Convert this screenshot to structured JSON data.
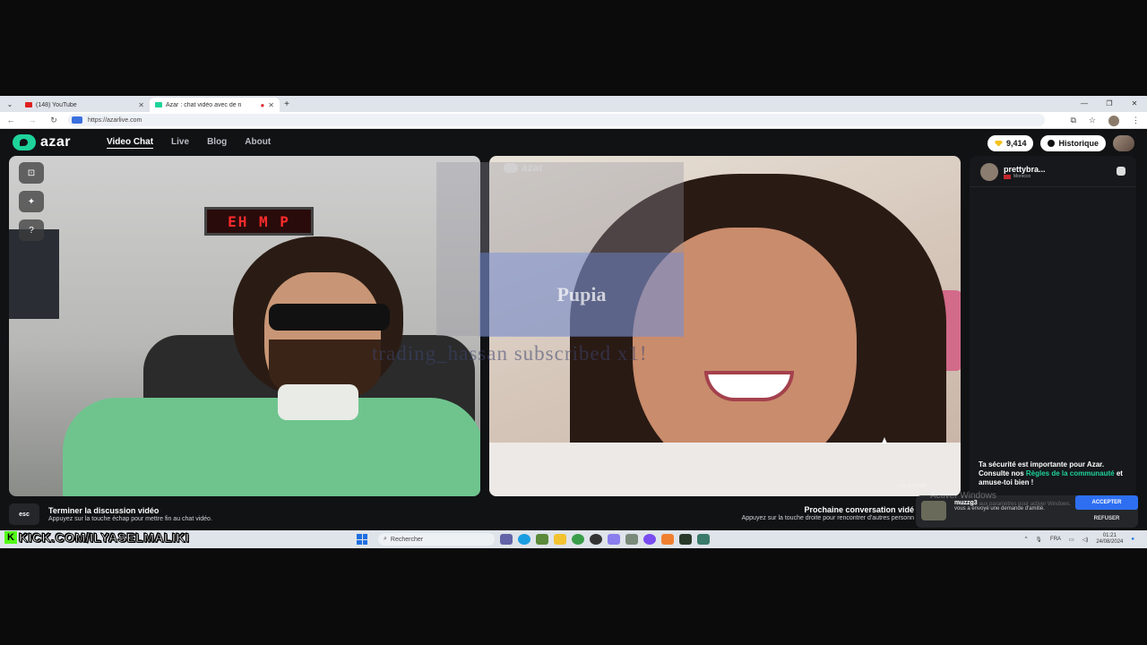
{
  "browser": {
    "tabs": [
      {
        "title": "(148) YouTube",
        "fav_color": "#e02020"
      },
      {
        "title": "Azar : chat vidéo avec de n",
        "fav_color": "#1ed39a"
      }
    ],
    "url": "https://azarlive.com"
  },
  "app": {
    "brand": "azar",
    "nav": [
      "Video Chat",
      "Live",
      "Blog",
      "About"
    ],
    "gems": "9,414",
    "history_label": "Historique",
    "accent": "#1ed39a"
  },
  "left_video": {
    "clock_text": "EH M P"
  },
  "right_video": {
    "watermark": "azar",
    "overlay_text": "Pupia",
    "tiny_id": "LIVE EXTRAS"
  },
  "stream_alert": "trading_hassan subscribed x1!",
  "side_panel": {
    "peer_name": "prettybra...",
    "peer_country": "Morocco",
    "safety_prefix": "Ta sécurité est importante pour Azar. Consulte nos ",
    "safety_link": "Règles de la communauté",
    "safety_suffix": " et amuse-toi bien !"
  },
  "hints": {
    "esc_key": "esc",
    "end_title": "Terminer la discussion vidéo",
    "end_sub": "Appuyez sur la touche échap pour mettre fin au chat vidéo.",
    "next_title": "Prochaine conversation vidé",
    "next_sub": "Appuyez sur la touche droite pour rencontrer d'autres personn"
  },
  "windows": {
    "activate_title": "Activer Windows",
    "activate_sub": "Accédez aux paramètres pour activer Windows."
  },
  "notification": {
    "user": "muzzg3",
    "message": "vous a envoyé une demande d'amitié.",
    "accept": "ACCEPTER",
    "refuse": "REFUSER"
  },
  "overlay_brand": "KICK.COM/ILYASELMALIKI",
  "taskbar": {
    "search_placeholder": "Rechercher",
    "lang": "FRA",
    "time": "01:21",
    "date": "24/08/2024"
  }
}
